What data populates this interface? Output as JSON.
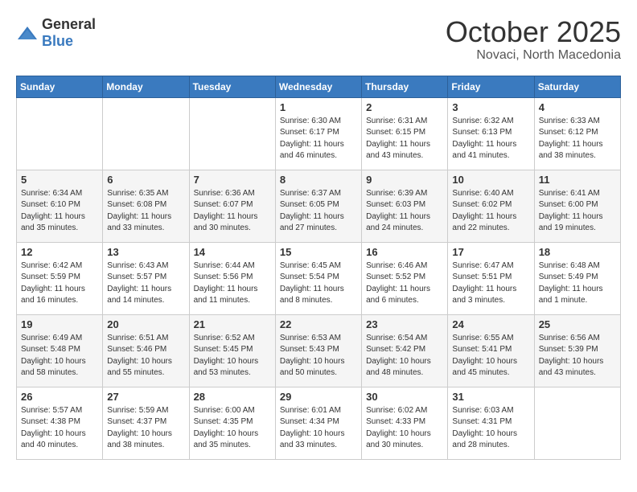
{
  "header": {
    "logo_general": "General",
    "logo_blue": "Blue",
    "month_title": "October 2025",
    "location": "Novaci, North Macedonia"
  },
  "days_of_week": [
    "Sunday",
    "Monday",
    "Tuesday",
    "Wednesday",
    "Thursday",
    "Friday",
    "Saturday"
  ],
  "weeks": [
    [
      {
        "day": "",
        "info": ""
      },
      {
        "day": "",
        "info": ""
      },
      {
        "day": "",
        "info": ""
      },
      {
        "day": "1",
        "info": "Sunrise: 6:30 AM\nSunset: 6:17 PM\nDaylight: 11 hours\nand 46 minutes."
      },
      {
        "day": "2",
        "info": "Sunrise: 6:31 AM\nSunset: 6:15 PM\nDaylight: 11 hours\nand 43 minutes."
      },
      {
        "day": "3",
        "info": "Sunrise: 6:32 AM\nSunset: 6:13 PM\nDaylight: 11 hours\nand 41 minutes."
      },
      {
        "day": "4",
        "info": "Sunrise: 6:33 AM\nSunset: 6:12 PM\nDaylight: 11 hours\nand 38 minutes."
      }
    ],
    [
      {
        "day": "5",
        "info": "Sunrise: 6:34 AM\nSunset: 6:10 PM\nDaylight: 11 hours\nand 35 minutes."
      },
      {
        "day": "6",
        "info": "Sunrise: 6:35 AM\nSunset: 6:08 PM\nDaylight: 11 hours\nand 33 minutes."
      },
      {
        "day": "7",
        "info": "Sunrise: 6:36 AM\nSunset: 6:07 PM\nDaylight: 11 hours\nand 30 minutes."
      },
      {
        "day": "8",
        "info": "Sunrise: 6:37 AM\nSunset: 6:05 PM\nDaylight: 11 hours\nand 27 minutes."
      },
      {
        "day": "9",
        "info": "Sunrise: 6:39 AM\nSunset: 6:03 PM\nDaylight: 11 hours\nand 24 minutes."
      },
      {
        "day": "10",
        "info": "Sunrise: 6:40 AM\nSunset: 6:02 PM\nDaylight: 11 hours\nand 22 minutes."
      },
      {
        "day": "11",
        "info": "Sunrise: 6:41 AM\nSunset: 6:00 PM\nDaylight: 11 hours\nand 19 minutes."
      }
    ],
    [
      {
        "day": "12",
        "info": "Sunrise: 6:42 AM\nSunset: 5:59 PM\nDaylight: 11 hours\nand 16 minutes."
      },
      {
        "day": "13",
        "info": "Sunrise: 6:43 AM\nSunset: 5:57 PM\nDaylight: 11 hours\nand 14 minutes."
      },
      {
        "day": "14",
        "info": "Sunrise: 6:44 AM\nSunset: 5:56 PM\nDaylight: 11 hours\nand 11 minutes."
      },
      {
        "day": "15",
        "info": "Sunrise: 6:45 AM\nSunset: 5:54 PM\nDaylight: 11 hours\nand 8 minutes."
      },
      {
        "day": "16",
        "info": "Sunrise: 6:46 AM\nSunset: 5:52 PM\nDaylight: 11 hours\nand 6 minutes."
      },
      {
        "day": "17",
        "info": "Sunrise: 6:47 AM\nSunset: 5:51 PM\nDaylight: 11 hours\nand 3 minutes."
      },
      {
        "day": "18",
        "info": "Sunrise: 6:48 AM\nSunset: 5:49 PM\nDaylight: 11 hours\nand 1 minute."
      }
    ],
    [
      {
        "day": "19",
        "info": "Sunrise: 6:49 AM\nSunset: 5:48 PM\nDaylight: 10 hours\nand 58 minutes."
      },
      {
        "day": "20",
        "info": "Sunrise: 6:51 AM\nSunset: 5:46 PM\nDaylight: 10 hours\nand 55 minutes."
      },
      {
        "day": "21",
        "info": "Sunrise: 6:52 AM\nSunset: 5:45 PM\nDaylight: 10 hours\nand 53 minutes."
      },
      {
        "day": "22",
        "info": "Sunrise: 6:53 AM\nSunset: 5:43 PM\nDaylight: 10 hours\nand 50 minutes."
      },
      {
        "day": "23",
        "info": "Sunrise: 6:54 AM\nSunset: 5:42 PM\nDaylight: 10 hours\nand 48 minutes."
      },
      {
        "day": "24",
        "info": "Sunrise: 6:55 AM\nSunset: 5:41 PM\nDaylight: 10 hours\nand 45 minutes."
      },
      {
        "day": "25",
        "info": "Sunrise: 6:56 AM\nSunset: 5:39 PM\nDaylight: 10 hours\nand 43 minutes."
      }
    ],
    [
      {
        "day": "26",
        "info": "Sunrise: 5:57 AM\nSunset: 4:38 PM\nDaylight: 10 hours\nand 40 minutes."
      },
      {
        "day": "27",
        "info": "Sunrise: 5:59 AM\nSunset: 4:37 PM\nDaylight: 10 hours\nand 38 minutes."
      },
      {
        "day": "28",
        "info": "Sunrise: 6:00 AM\nSunset: 4:35 PM\nDaylight: 10 hours\nand 35 minutes."
      },
      {
        "day": "29",
        "info": "Sunrise: 6:01 AM\nSunset: 4:34 PM\nDaylight: 10 hours\nand 33 minutes."
      },
      {
        "day": "30",
        "info": "Sunrise: 6:02 AM\nSunset: 4:33 PM\nDaylight: 10 hours\nand 30 minutes."
      },
      {
        "day": "31",
        "info": "Sunrise: 6:03 AM\nSunset: 4:31 PM\nDaylight: 10 hours\nand 28 minutes."
      },
      {
        "day": "",
        "info": ""
      }
    ]
  ]
}
